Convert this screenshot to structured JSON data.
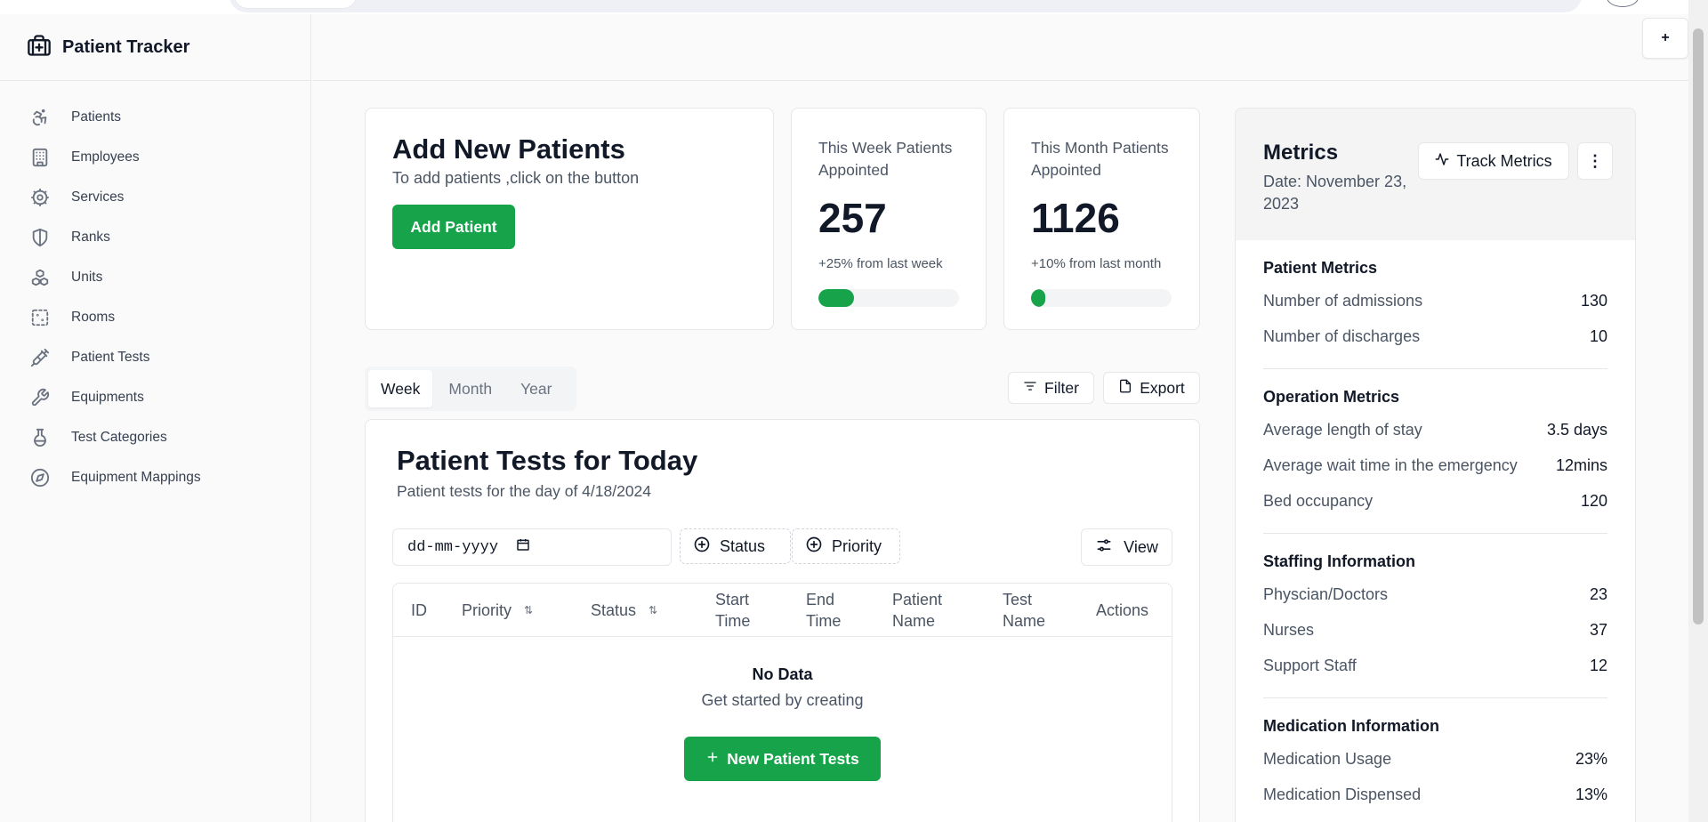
{
  "app": {
    "title": "Patient Tracker"
  },
  "sidebar": {
    "items": [
      {
        "label": "Patients",
        "icon": "accessibility-icon"
      },
      {
        "label": "Employees",
        "icon": "building-icon"
      },
      {
        "label": "Services",
        "icon": "cog-icon"
      },
      {
        "label": "Ranks",
        "icon": "shield-icon"
      },
      {
        "label": "Units",
        "icon": "boxes-icon"
      },
      {
        "label": "Rooms",
        "icon": "dashed-square-icon"
      },
      {
        "label": "Patient Tests",
        "icon": "syringe-icon"
      },
      {
        "label": "Equipments",
        "icon": "wrench-icon"
      },
      {
        "label": "Test Categories",
        "icon": "flask-icon"
      },
      {
        "label": "Equipment Mappings",
        "icon": "compass-icon"
      }
    ]
  },
  "header": {
    "plus_label": "+"
  },
  "add_card": {
    "title": "Add New Patients",
    "subtitle": "To add patients ,click on the button",
    "button": "Add Patient"
  },
  "stats": {
    "week": {
      "label": "This Week Patients Appointed",
      "value": "257",
      "change": "+25% from last week",
      "progress": 0.25
    },
    "month": {
      "label": "This Month Patients Appointed",
      "value": "1126",
      "change": "+10% from last month",
      "progress": 0.1
    }
  },
  "tabs": [
    "Week",
    "Month",
    "Year"
  ],
  "active_tab": "Week",
  "toolbar": {
    "filter": "Filter",
    "export": "Export"
  },
  "tests": {
    "title": "Patient Tests for Today",
    "subtitle": "Patient tests for the day of 4/18/2024",
    "date_placeholder": "dd-mm-yyyy",
    "status_filter": "Status",
    "priority_filter": "Priority",
    "view": "View",
    "columns": [
      "ID",
      "Priority",
      "Status",
      "Start Time",
      "End Time",
      "Patient Name",
      "Test Name",
      "Actions"
    ],
    "empty_title": "No Data",
    "empty_sub": "Get started by creating",
    "new_button": "New Patient Tests"
  },
  "metrics": {
    "title": "Metrics",
    "date": "Date: November 23, 2023",
    "track_button": "Track Metrics",
    "more": "⋮",
    "sections": [
      {
        "title": "Patient Metrics",
        "rows": [
          {
            "label": "Number of admissions",
            "value": "130"
          },
          {
            "label": "Number of discharges",
            "value": "10"
          }
        ]
      },
      {
        "title": "Operation Metrics",
        "rows": [
          {
            "label": "Average length of stay",
            "value": "3.5 days"
          },
          {
            "label": "Average wait time in the emergency",
            "value": "12mins"
          },
          {
            "label": "Bed occupancy",
            "value": "120"
          }
        ]
      },
      {
        "title": "Staffing Information",
        "rows": [
          {
            "label": "Physcian/Doctors",
            "value": "23"
          },
          {
            "label": "Nurses",
            "value": "37"
          },
          {
            "label": "Support Staff",
            "value": "12"
          }
        ]
      },
      {
        "title": "Medication Information",
        "rows": [
          {
            "label": "Medication Usage",
            "value": "23%"
          },
          {
            "label": "Medication Dispensed",
            "value": "13%"
          }
        ]
      }
    ]
  },
  "colors": {
    "accent": "#16a34a",
    "border": "#e5e7eb",
    "muted": "#4b5563"
  }
}
